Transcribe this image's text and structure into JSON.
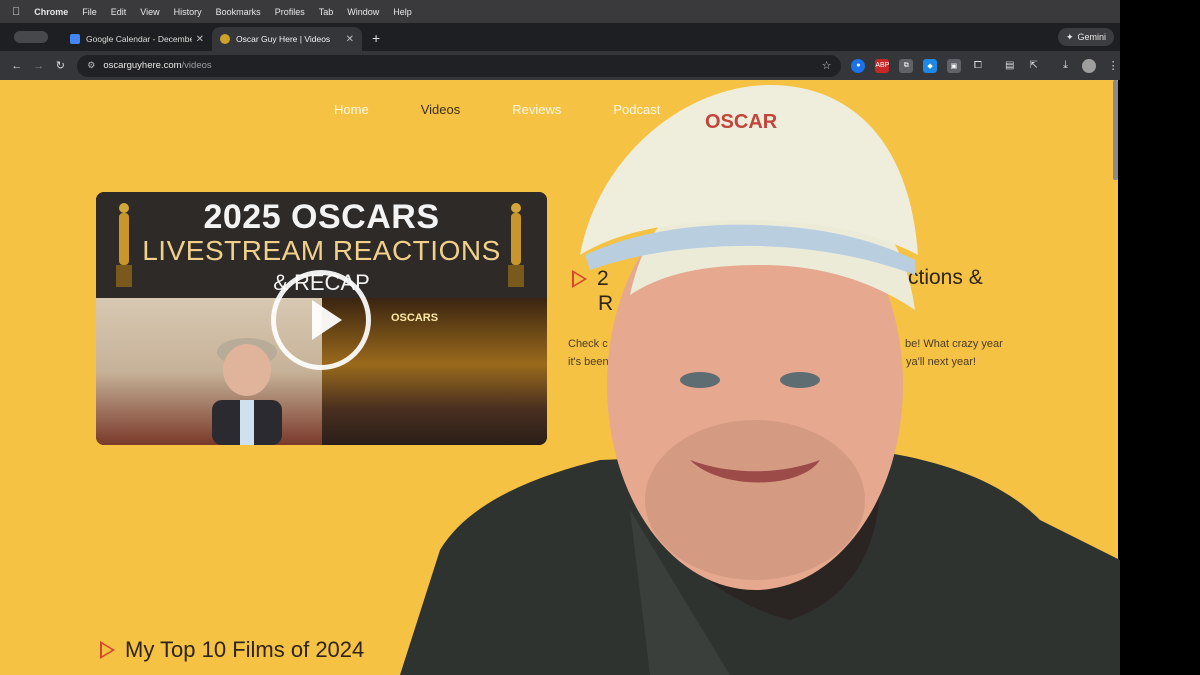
{
  "menubar": {
    "items": [
      "Chrome",
      "File",
      "Edit",
      "View",
      "History",
      "Bookmarks",
      "Profiles",
      "Tab",
      "Window",
      "Help"
    ]
  },
  "tabs": [
    {
      "title": "Google Calendar - December",
      "active": false
    },
    {
      "title": "Oscar Guy Here | Videos",
      "active": true
    }
  ],
  "gemini_label": "Gemini",
  "address": {
    "host": "oscarguyhere.com",
    "path": "/videos"
  },
  "site_nav": [
    "Home",
    "Videos",
    "Reviews",
    "Podcast"
  ],
  "active_nav": "Videos",
  "featured_video": {
    "thumb_line1": "2025 OSCARS",
    "thumb_line2": "LIVESTREAM REACTIONS",
    "thumb_line3": "& RECAP",
    "thumb_stage_label": "OSCARS",
    "title_start": "2",
    "title_start_line2": "R",
    "title_end": "ctions &",
    "desc_line1_left": "Check c",
    "desc_line1_right": "be! What crazy year",
    "desc_line2_left": "it's been",
    "desc_line2_right": "ya'll next year!"
  },
  "list_title": "My Top 10 Films of 2024",
  "overlay_cap_text": "OSCAR",
  "colors": {
    "page_bg": "#f5c244",
    "accent": "#d6472b"
  }
}
